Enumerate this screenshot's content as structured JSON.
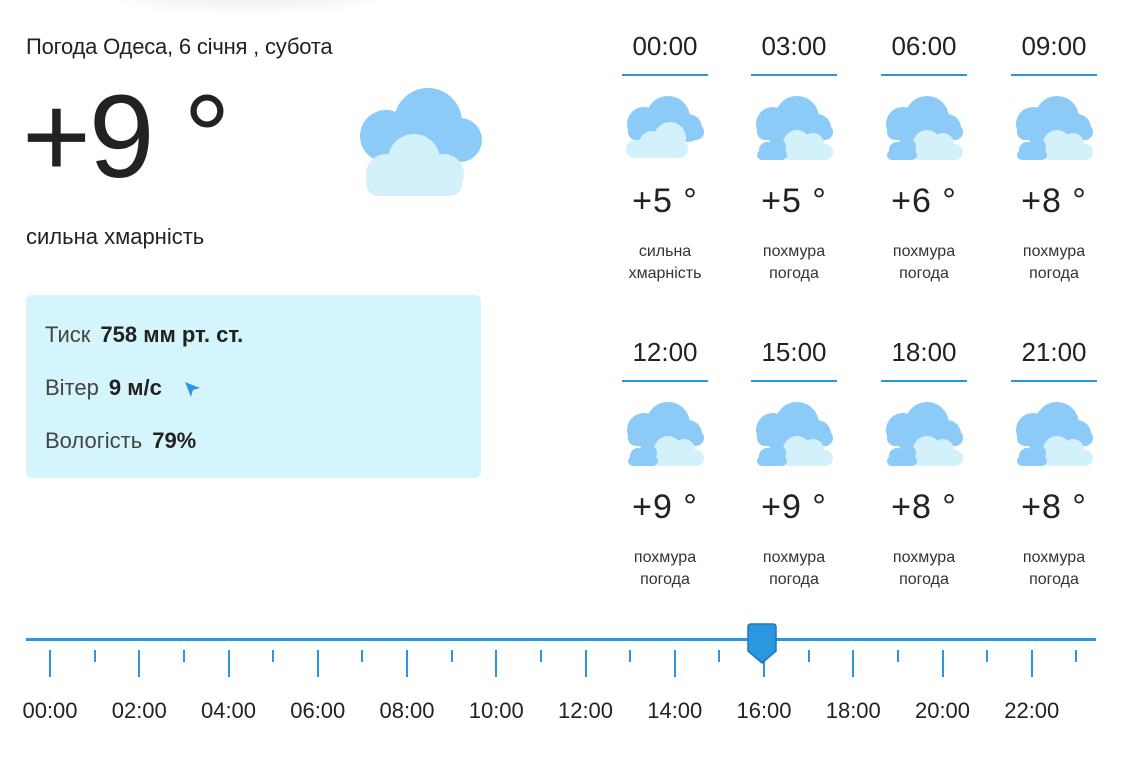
{
  "header": {
    "title": "Погода Одеса, 6 січня , субота"
  },
  "current": {
    "temperature": "+9 °",
    "description": "сильна хмарність",
    "icon": "cloud-icon"
  },
  "details": {
    "pressure_label": "Тиск",
    "pressure_value": "758 мм рт. ст.",
    "wind_label": "Вітер",
    "wind_value": "9 м/с",
    "wind_icon": "wind-direction-arrow-icon",
    "humidity_label": "Вологість",
    "humidity_value": "79%"
  },
  "forecast": [
    {
      "time": "00:00",
      "temp": "+5 °",
      "desc1": "сильна",
      "desc2": "хмарність",
      "icon": "overcast-cloud-icon"
    },
    {
      "time": "03:00",
      "temp": "+5 °",
      "desc1": "похмура",
      "desc2": "погода",
      "icon": "cloudy-icon"
    },
    {
      "time": "06:00",
      "temp": "+6 °",
      "desc1": "похмура",
      "desc2": "погода",
      "icon": "cloudy-icon"
    },
    {
      "time": "09:00",
      "temp": "+8 °",
      "desc1": "похмура",
      "desc2": "погода",
      "icon": "cloudy-icon"
    },
    {
      "time": "12:00",
      "temp": "+9 °",
      "desc1": "похмура",
      "desc2": "погода",
      "icon": "cloudy-icon"
    },
    {
      "time": "15:00",
      "temp": "+9 °",
      "desc1": "похмура",
      "desc2": "погода",
      "icon": "cloudy-icon"
    },
    {
      "time": "18:00",
      "temp": "+8 °",
      "desc1": "похмура",
      "desc2": "погода",
      "icon": "cloudy-icon"
    },
    {
      "time": "21:00",
      "temp": "+8 °",
      "desc1": "похмура",
      "desc2": "погода",
      "icon": "cloudy-icon"
    }
  ],
  "timeline": {
    "labels": [
      "00:00",
      "02:00",
      "04:00",
      "06:00",
      "08:00",
      "10:00",
      "12:00",
      "14:00",
      "16:00",
      "18:00",
      "20:00",
      "22:00"
    ],
    "selected": "16:00"
  },
  "colors": {
    "accent": "#2b97e0",
    "panel": "#d5f5fc",
    "cloud_dark": "#8ccaf7",
    "cloud_light": "#d3f1fb"
  }
}
